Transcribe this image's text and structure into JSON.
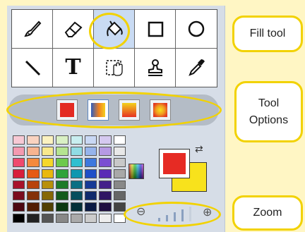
{
  "tools": [
    {
      "name": "brush-icon"
    },
    {
      "name": "eraser-icon"
    },
    {
      "name": "paint-bucket-icon",
      "selected": true
    },
    {
      "name": "rectangle-icon"
    },
    {
      "name": "ellipse-icon"
    },
    {
      "name": "line-icon"
    },
    {
      "name": "text-icon",
      "label": "T"
    },
    {
      "name": "selection-hand-icon"
    },
    {
      "name": "stamp-icon"
    },
    {
      "name": "eyedropper-icon"
    }
  ],
  "fill_options": [
    {
      "name": "fill-solid",
      "selected": false
    },
    {
      "name": "fill-linear-gradient",
      "selected": true
    },
    {
      "name": "fill-vertical-gradient",
      "selected": false
    },
    {
      "name": "fill-radial-gradient",
      "selected": false
    }
  ],
  "palette": [
    [
      "#f7c9d4",
      "#f9d3c0",
      "#fbf2c0",
      "#d9f0c4",
      "#c8eef0",
      "#c9d8f4",
      "#d5c9f0",
      "#ffffff"
    ],
    [
      "#f49ab0",
      "#f7b490",
      "#f8e88c",
      "#b5e490",
      "#90dce4",
      "#96b4ec",
      "#b69ae4",
      "#e8e8e8"
    ],
    [
      "#ef4a6e",
      "#f58a3c",
      "#f5d72a",
      "#6cc94c",
      "#2fbfd0",
      "#3d78de",
      "#7a4fd2",
      "#c8c8c8"
    ],
    [
      "#d81e3c",
      "#e65a14",
      "#e9b80e",
      "#2ea33a",
      "#0f97b0",
      "#1f4fc8",
      "#5a2bb6",
      "#a8a8a8"
    ],
    [
      "#a8122a",
      "#b8420c",
      "#b8900a",
      "#1c7a28",
      "#0a6f84",
      "#163a96",
      "#43208a",
      "#888888"
    ],
    [
      "#7a0c1e",
      "#843008",
      "#866806",
      "#125a1c",
      "#064e5e",
      "#0f2a6c",
      "#2f1664",
      "#666666"
    ],
    [
      "#4c0812",
      "#521e04",
      "#524004",
      "#0b3812",
      "#043038",
      "#0a1a44",
      "#1e0e40",
      "#444444"
    ],
    [
      "#000000",
      "#222222",
      "#555555",
      "#888888",
      "#aaaaaa",
      "#cccccc",
      "#eeeeee",
      "#ffffff"
    ]
  ],
  "colors": {
    "foreground": "#e62b24",
    "background": "#f8e21c",
    "highlight": "#f2d200"
  },
  "zoom": {
    "level_steps": 5,
    "current_step": 3
  },
  "callouts": {
    "fill_tool": "Fill tool",
    "tool_options_line1": "Tool",
    "tool_options_line2": "Options",
    "zoom": "Zoom"
  }
}
